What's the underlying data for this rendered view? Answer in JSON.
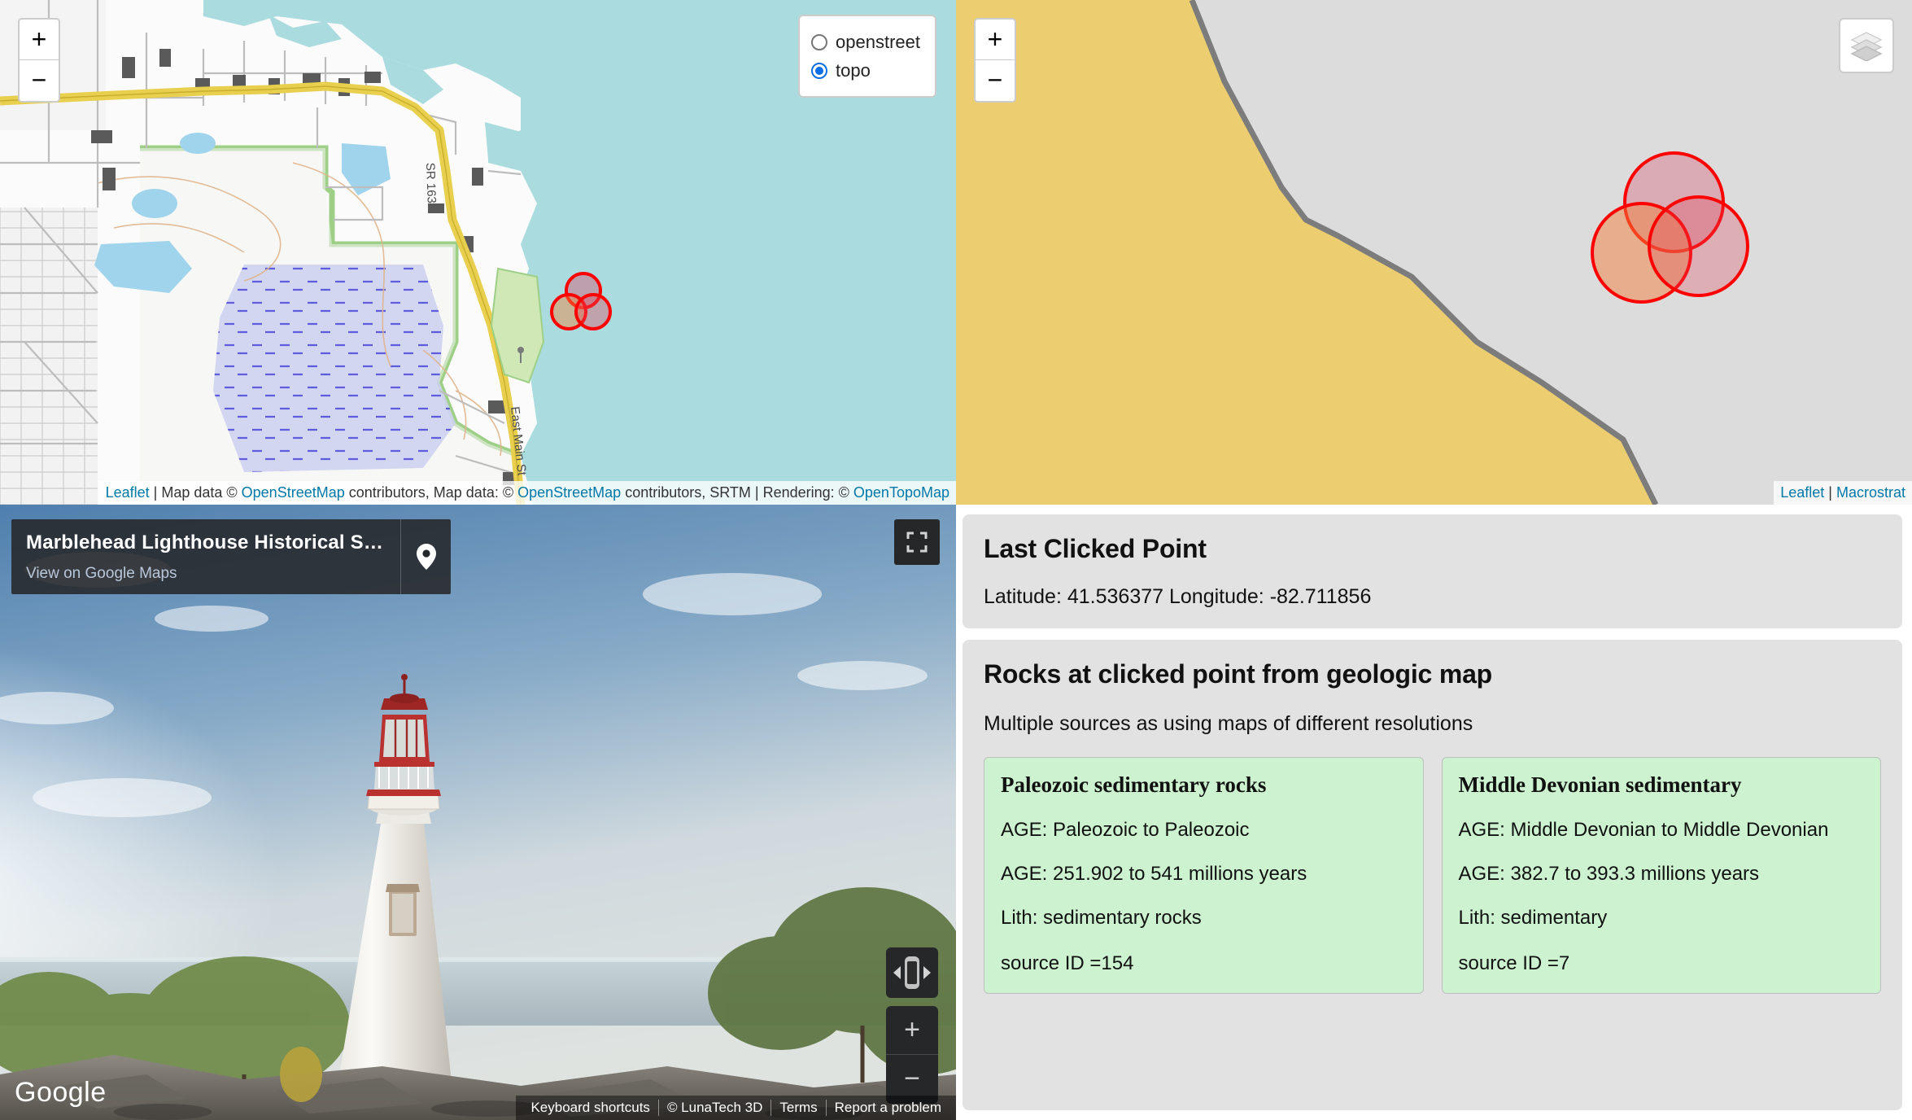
{
  "topo_map": {
    "zoom_in_label": "+",
    "zoom_out_label": "−",
    "layer_options": [
      {
        "label": "openstreet",
        "selected": false
      },
      {
        "label": "topo",
        "selected": true
      }
    ],
    "attribution": {
      "leaflet": "Leaflet",
      "sep1": " | Map data © ",
      "osm1": "OpenStreetMap",
      "mid": " contributors, Map data: © ",
      "osm2": "OpenStreetMap",
      "mid2": " contributors, SRTM | Rendering: © ",
      "otm": "OpenTopoMap"
    },
    "road_labels": [
      "SR 163",
      "East Main St"
    ],
    "marker_color": "#ff0000",
    "water_color": "#aadcdf",
    "park_color": "#cfe8b5"
  },
  "geo_map": {
    "zoom_in_label": "+",
    "zoom_out_label": "−",
    "layers_icon": "layers-icon",
    "attribution": {
      "leaflet": "Leaflet",
      "sep": " | ",
      "source": "Macrostrat"
    },
    "unit_color": "#ecce70",
    "background_color": "#dcdcdc",
    "boundary_color": "#7c7c7c",
    "marker_color": "#ff0000"
  },
  "street_view": {
    "title": "Marblehead Lighthouse Historical Society at Marblehea…",
    "link_label": "View on Google Maps",
    "brand": "Google",
    "fullscreen_icon": "fullscreen-icon",
    "pin_icon": "map-pin-icon",
    "pan_icon": "pan-control-icon",
    "zoom_in_label": "+",
    "zoom_out_label": "−",
    "footer": [
      "Keyboard shortcuts",
      "© LunaTech 3D",
      "Terms",
      "Report a problem"
    ]
  },
  "info_panel": {
    "last_clicked": {
      "heading": "Last Clicked Point",
      "coords_text": "Latitude: 41.536377 Longitude: -82.711856",
      "latitude": 41.536377,
      "longitude": -82.711856
    },
    "rocks": {
      "heading": "Rocks at clicked point from geologic map",
      "subtitle": "Multiple sources as using maps of different resolutions",
      "card_color": "#ccf2cf",
      "items": [
        {
          "name": "Paleozoic sedimentary rocks",
          "age_text": "AGE: Paleozoic to Paleozoic",
          "age_numeric": "AGE: 251.902 to 541 millions years",
          "lith": "Lith: sedimentary rocks",
          "source": "source ID =154"
        },
        {
          "name": "Middle Devonian sedimentary",
          "age_text": "AGE: Middle Devonian to Middle Devonian",
          "age_numeric": "AGE: 382.7 to 393.3 millions years",
          "lith": "Lith: sedimentary",
          "source": "source ID =7"
        }
      ]
    }
  }
}
